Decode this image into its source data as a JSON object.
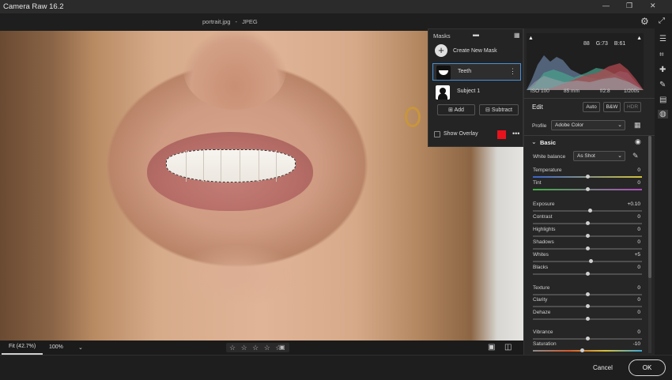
{
  "app": {
    "title": "Camera Raw 16.2",
    "filename": "portrait.jpg",
    "separator": "-",
    "format": "JPEG"
  },
  "masks": {
    "header": "Masks",
    "create_new": "Create New Mask",
    "items": [
      {
        "label": "Teeth"
      },
      {
        "label": "Subject 1"
      }
    ],
    "add_label": "Add",
    "subtract_label": "Subtract",
    "show_overlay_label": "Show Overlay",
    "overlay_color": "#e8121d"
  },
  "histogram": {
    "r_label": "",
    "r_value": "88",
    "g_label": "G:",
    "g_value": "73",
    "b_label": "B:",
    "b_value": "61"
  },
  "camera_info": {
    "iso": "ISO 100",
    "focal": "85 mm",
    "aperture": "f/2.8",
    "shutter": "1/200s"
  },
  "edit": {
    "title": "Edit",
    "auto": "Auto",
    "bw": "B&W",
    "hdr": "HDR"
  },
  "profile": {
    "label": "Profile",
    "value": "Adobe Color"
  },
  "basic": {
    "title": "Basic",
    "wb_label": "White balance",
    "wb_value": "As Shot"
  },
  "sliders": [
    {
      "label": "Temperature",
      "value": "0",
      "pos": 0.5
    },
    {
      "label": "Tint",
      "value": "0",
      "pos": 0.5
    },
    {
      "label": "Exposure",
      "value": "+0.10",
      "pos": 0.52
    },
    {
      "label": "Contrast",
      "value": "0",
      "pos": 0.5
    },
    {
      "label": "Highlights",
      "value": "0",
      "pos": 0.5
    },
    {
      "label": "Shadows",
      "value": "0",
      "pos": 0.5
    },
    {
      "label": "Whites",
      "value": "+5",
      "pos": 0.53
    },
    {
      "label": "Blacks",
      "value": "0",
      "pos": 0.5
    },
    {
      "label": "Texture",
      "value": "0",
      "pos": 0.5
    },
    {
      "label": "Clarity",
      "value": "0",
      "pos": 0.5
    },
    {
      "label": "Dehaze",
      "value": "0",
      "pos": 0.5
    },
    {
      "label": "Vibrance",
      "value": "0",
      "pos": 0.5
    },
    {
      "label": "Saturation",
      "value": "-10",
      "pos": 0.45
    }
  ],
  "bottom": {
    "fit": "Fit (42.7%)",
    "zoom": "100%",
    "stars": "☆ ☆ ☆ ☆ ☆"
  },
  "footer": {
    "cancel": "Cancel",
    "ok": "OK"
  }
}
